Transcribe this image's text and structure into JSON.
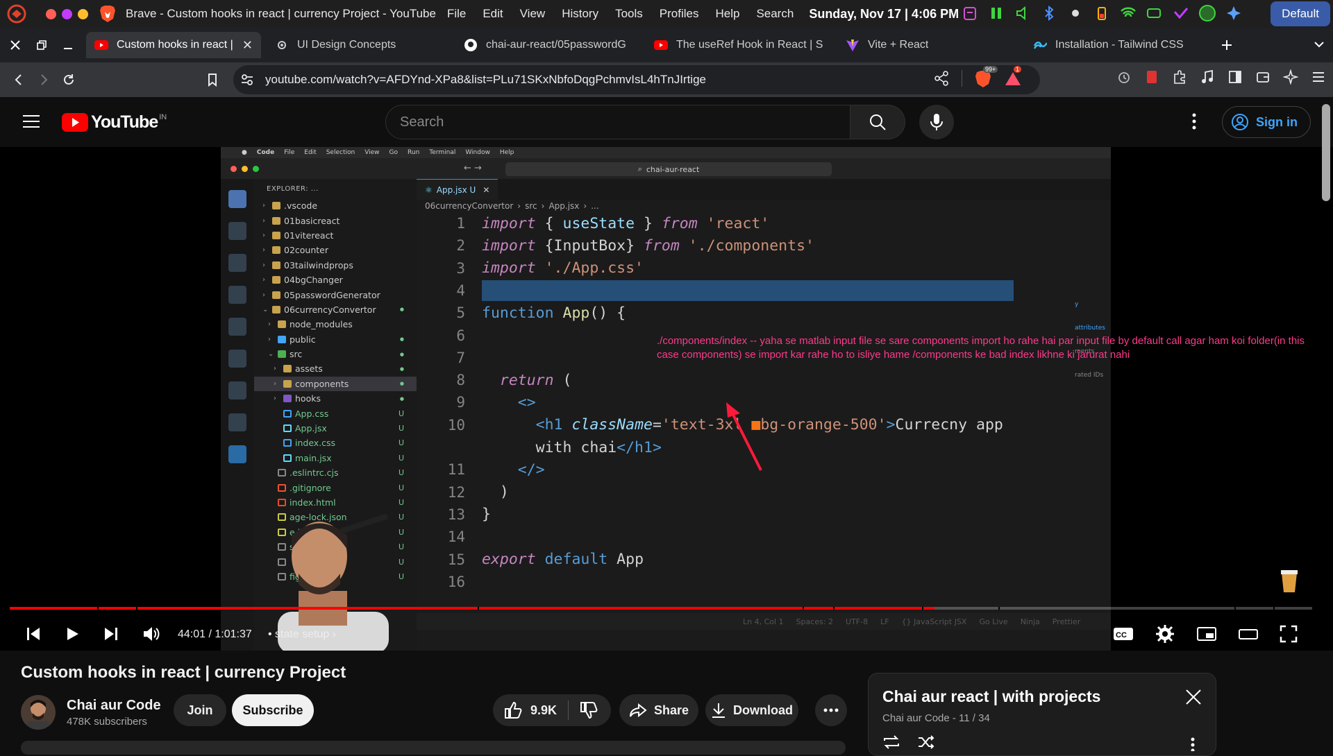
{
  "os": {
    "app_title": "Brave - Custom hooks in react | currency Project - YouTube",
    "menus": [
      "File",
      "Edit",
      "View",
      "History",
      "Tools",
      "Profiles",
      "Help",
      "Search"
    ],
    "clock": "Sunday, Nov 17 | 4:06 PM",
    "workspace_button": "Default"
  },
  "tabs": [
    {
      "title": "Custom hooks in react | c",
      "active": true,
      "icon": "youtube-icon"
    },
    {
      "title": "UI Design Concepts",
      "active": false,
      "icon": "gear-icon"
    },
    {
      "title": "chai-aur-react/05passwordG",
      "active": false,
      "icon": "github-icon"
    },
    {
      "title": "The useRef Hook in React | S",
      "active": false,
      "icon": "youtube-icon"
    },
    {
      "title": "Vite + React",
      "active": false,
      "icon": "vite-icon"
    },
    {
      "title": "Installation - Tailwind CSS",
      "active": false,
      "icon": "tailwind-icon"
    }
  ],
  "address": {
    "url": "youtube.com/watch?v=AFDYnd-XPa8&list=PLu71SKxNbfoDqgPchmvIsL4hTnJIrtige",
    "shield_badge": "99+",
    "alert_badge": "1"
  },
  "youtube": {
    "logo_text": "YouTube",
    "country_code": "IN",
    "search_placeholder": "Search",
    "signin_label": "Sign in"
  },
  "video_content": {
    "mac_menu": [
      "Code",
      "File",
      "Edit",
      "Selection",
      "View",
      "Go",
      "Run",
      "Terminal",
      "Window",
      "Help"
    ],
    "command_center": "chai-aur-react",
    "explorer_label": "EXPLORER: ...",
    "editor_tab": "App.jsx  U",
    "breadcrumbs": [
      "06currencyConvertor",
      "src",
      "App.jsx",
      "..."
    ],
    "file_tree": [
      {
        "name": ".vscode",
        "depth": 0,
        "type": "folder",
        "open": false,
        "badge": ""
      },
      {
        "name": "01basicreact",
        "depth": 0,
        "type": "folder",
        "open": false,
        "badge": ""
      },
      {
        "name": "01vitereact",
        "depth": 0,
        "type": "folder",
        "open": false,
        "badge": ""
      },
      {
        "name": "02counter",
        "depth": 0,
        "type": "folder",
        "open": false,
        "badge": ""
      },
      {
        "name": "03tailwindprops",
        "depth": 0,
        "type": "folder",
        "open": false,
        "badge": ""
      },
      {
        "name": "04bgChanger",
        "depth": 0,
        "type": "folder",
        "open": false,
        "badge": ""
      },
      {
        "name": "05passwordGenerator",
        "depth": 0,
        "type": "folder",
        "open": false,
        "badge": ""
      },
      {
        "name": "06currencyConvertor",
        "depth": 0,
        "type": "folder",
        "open": true,
        "badge": "●"
      },
      {
        "name": "node_modules",
        "depth": 1,
        "type": "folder",
        "open": false,
        "badge": ""
      },
      {
        "name": "public",
        "depth": 1,
        "type": "folder",
        "open": false,
        "badge": "●"
      },
      {
        "name": "src",
        "depth": 1,
        "type": "folder",
        "open": true,
        "badge": "●"
      },
      {
        "name": "assets",
        "depth": 2,
        "type": "folder",
        "open": false,
        "badge": "●"
      },
      {
        "name": "components",
        "depth": 2,
        "type": "folder",
        "open": false,
        "badge": "●",
        "selected": true
      },
      {
        "name": "hooks",
        "depth": 2,
        "type": "folder",
        "open": false,
        "badge": "●"
      },
      {
        "name": "App.css",
        "depth": 2,
        "type": "file",
        "badge": "U"
      },
      {
        "name": "App.jsx",
        "depth": 2,
        "type": "file",
        "badge": "U"
      },
      {
        "name": "index.css",
        "depth": 2,
        "type": "file",
        "badge": "U"
      },
      {
        "name": "main.jsx",
        "depth": 2,
        "type": "file",
        "badge": "U"
      },
      {
        "name": ".eslintrc.cjs",
        "depth": 1,
        "type": "file",
        "badge": "U"
      },
      {
        "name": ".gitignore",
        "depth": 1,
        "type": "file",
        "badge": "U"
      },
      {
        "name": "index.html",
        "depth": 1,
        "type": "file",
        "badge": "U"
      },
      {
        "name": "age-lock.json",
        "depth": 1,
        "type": "file",
        "badge": "U"
      },
      {
        "name": "e.json",
        "depth": 1,
        "type": "file",
        "badge": "U"
      },
      {
        "name": "s.confi",
        "depth": 1,
        "type": "file",
        "badge": "U"
      },
      {
        "name": "",
        "depth": 1,
        "type": "file",
        "badge": "U"
      },
      {
        "name": "fig.js",
        "depth": 1,
        "type": "file",
        "badge": "U"
      }
    ],
    "code_lines": [
      {
        "n": "1",
        "tokens": [
          [
            "kw",
            "import"
          ],
          [
            "plain",
            " { "
          ],
          [
            "var",
            "useState"
          ],
          [
            "plain",
            " } "
          ],
          [
            "kw",
            "from"
          ],
          [
            "str",
            " 'react'"
          ]
        ]
      },
      {
        "n": "2",
        "tokens": [
          [
            "kw",
            "import"
          ],
          [
            "plain",
            " {InputBox} "
          ],
          [
            "kw",
            "from"
          ],
          [
            "str",
            " './components'"
          ]
        ]
      },
      {
        "n": "3",
        "tokens": [
          [
            "kw",
            "import"
          ],
          [
            "str",
            " './App.css'"
          ]
        ]
      },
      {
        "n": "4",
        "tokens": [
          [
            "plain",
            "                                                 "
          ]
        ],
        "highlight": true
      },
      {
        "n": "5",
        "tokens": [
          [
            "kw2",
            "function"
          ],
          [
            "fn",
            " App"
          ],
          [
            "plain",
            "() {"
          ]
        ]
      },
      {
        "n": "6",
        "tokens": [
          [
            "plain",
            "  "
          ]
        ]
      },
      {
        "n": "7",
        "tokens": [
          [
            "plain",
            ""
          ]
        ]
      },
      {
        "n": "8",
        "tokens": [
          [
            "plain",
            "  "
          ],
          [
            "kw",
            "return"
          ],
          [
            "plain",
            " ("
          ]
        ]
      },
      {
        "n": "9",
        "tokens": [
          [
            "plain",
            "    "
          ],
          [
            "tag",
            "<>"
          ]
        ]
      },
      {
        "n": "10",
        "tokens": [
          [
            "plain",
            "      "
          ],
          [
            "tag",
            "<h1"
          ],
          [
            "attr",
            " className"
          ],
          [
            "plain",
            "="
          ],
          [
            "str",
            "'text-3xl "
          ],
          [
            "plain",
            "■"
          ],
          [
            "str",
            "bg-orange-500'"
          ],
          [
            "tag",
            ">"
          ],
          [
            "plain",
            "Currecny app"
          ]
        ]
      },
      {
        "n": "",
        "tokens": [
          [
            "plain",
            "      with chai"
          ],
          [
            "tag",
            "</h1>"
          ]
        ]
      },
      {
        "n": "11",
        "tokens": [
          [
            "plain",
            "    "
          ],
          [
            "tag",
            "</>"
          ]
        ]
      },
      {
        "n": "12",
        "tokens": [
          [
            "plain",
            "  )"
          ]
        ]
      },
      {
        "n": "13",
        "tokens": [
          [
            "plain",
            "}"
          ]
        ]
      },
      {
        "n": "14",
        "tokens": [
          [
            "plain",
            ""
          ]
        ]
      },
      {
        "n": "15",
        "tokens": [
          [
            "kw",
            "export"
          ],
          [
            "kw2",
            " default"
          ],
          [
            "plain",
            " App"
          ]
        ]
      },
      {
        "n": "16",
        "tokens": [
          [
            "plain",
            ""
          ]
        ]
      }
    ],
    "status_items": [
      "Ln 4, Col 1",
      "Spaces: 2",
      "UTF-8",
      "LF",
      "{} JavaScript JSX",
      "Go Live",
      "Ninja",
      "Prettier"
    ],
    "annotation": "./components/index  -- yaha se matlab input file se sare components import ho rahe hai par input file by default call agar ham koi folder(in this case components) se import kar rahe ho to isliye hame /components ke bad index likhne ki jarurat nahi",
    "peek_labels": [
      "y attributes",
      "ments",
      "rated IDs"
    ]
  },
  "player": {
    "time_current": "44:01",
    "time_total": "1:01:37",
    "time_display": "44:01 / 1:01:37",
    "chapter": "• state setup",
    "progress_played_fraction": 0.71
  },
  "video": {
    "title": "Custom hooks in react | currency Project",
    "channel_name": "Chai aur Code",
    "subscribers": "478K subscribers",
    "join_label": "Join",
    "subscribe_label": "Subscribe",
    "likes": "9.9K",
    "share_label": "Share",
    "download_label": "Download"
  },
  "playlist": {
    "title": "Chai aur react | with projects",
    "subtitle": "Chai aur Code - 11 / 34"
  }
}
